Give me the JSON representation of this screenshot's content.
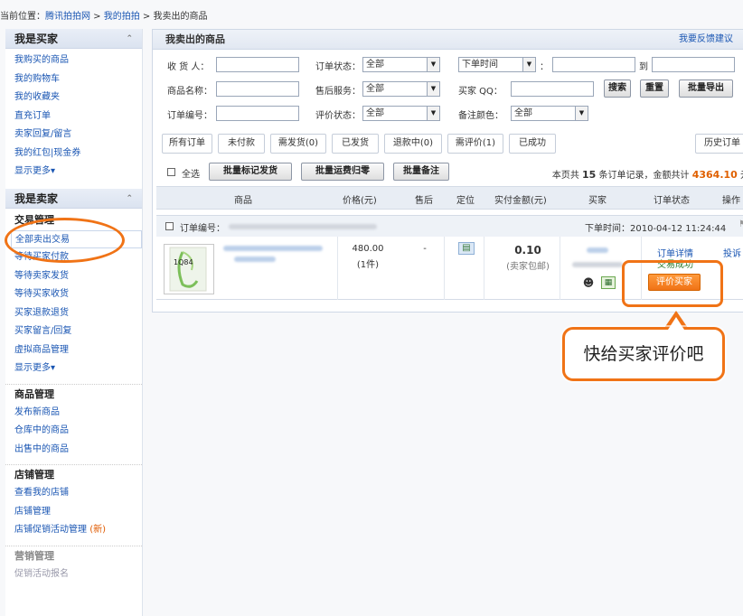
{
  "breadcrumb": {
    "prefix": "当前位置：",
    "root": "腾讯拍拍网",
    "sep1": " > ",
    "mid": "我的拍拍",
    "sep2": " > ",
    "current": "我卖出的商品"
  },
  "sidebar": {
    "buyer": {
      "title": "我是买家",
      "items": [
        "我购买的商品",
        "我的购物车",
        "我的收藏夹",
        "直充订单",
        "卖家回复/留言",
        "我的红包|现金券"
      ],
      "more": "显示更多▾"
    },
    "seller": {
      "title": "我是卖家",
      "trade_group": "交易管理",
      "trade_items": [
        "全部卖出交易",
        "等待买家付款",
        "等待卖家发货",
        "等待买家收货",
        "买家退款退货",
        "买家留言/回复",
        "虚拟商品管理"
      ],
      "more": "显示更多▾",
      "goods_group": "商品管理",
      "goods_items": [
        "发布新商品",
        "仓库中的商品",
        "出售中的商品"
      ],
      "shop_group": "店铺管理",
      "shop_items": [
        "查看我的店铺",
        "店铺管理"
      ],
      "shop_promo": "店铺促销活动管理",
      "shop_promo_tag": "(新)",
      "marketing_group": "营销管理",
      "marketing_items": [
        "促销活动报名"
      ]
    }
  },
  "main": {
    "title": "我卖出的商品",
    "feedback": "我要反馈建议",
    "filters": {
      "receiver_label": "收 货 人：",
      "order_status_label": "订单状态：",
      "order_status_value": "全部",
      "time_type_value": "下单时间",
      "time_colon": "：",
      "to_label": "到",
      "goods_name_label": "商品名称：",
      "after_sale_label": "售后服务：",
      "after_sale_value": "全部",
      "buyer_qq_label": "买家 QQ：",
      "search_btn": "搜索",
      "reset_btn": "重置",
      "export_btn": "批量导出",
      "order_no_label": "订单编号：",
      "rating_status_label": "评价状态：",
      "rating_status_value": "全部",
      "note_color_label": "备注颜色：",
      "note_color_value": "全部"
    },
    "tabs": [
      "所有订单",
      "未付款",
      "需发货(0)",
      "已发货",
      "退款中(0)",
      "需评价(1)",
      "已成功"
    ],
    "history_tab": "历史订单",
    "batch": {
      "select_all": "全选",
      "mark_ship": "批量标记发货",
      "freight_return": "批量运费归零",
      "batch_note": "批量备注",
      "summary_pre": "本页共 ",
      "summary_count": "15",
      "summary_mid": " 条订单记录，金额共计 ",
      "summary_amount": "4364.10",
      "summary_unit": " 元"
    },
    "table_head": [
      "商品",
      "价格(元)",
      "售后",
      "定位",
      "实付金额(元)",
      "买家",
      "订单状态",
      "操作"
    ],
    "order": {
      "order_no_label": "订单编号：",
      "order_time": "下单时间：2010-04-12 11:24:44",
      "price": "480.00",
      "qty": "(1件)",
      "after_sale": "-",
      "paid": "0.10",
      "paid_note": "(卖家包邮)",
      "detail_link": "订单详情",
      "status": "交易成功",
      "rate_btn": "评价买家",
      "complain": "投诉"
    }
  },
  "callout": {
    "text": "快给买家评价吧"
  },
  "colors": {
    "accent_orange": "#f07316",
    "link_blue": "#1a56b3"
  }
}
